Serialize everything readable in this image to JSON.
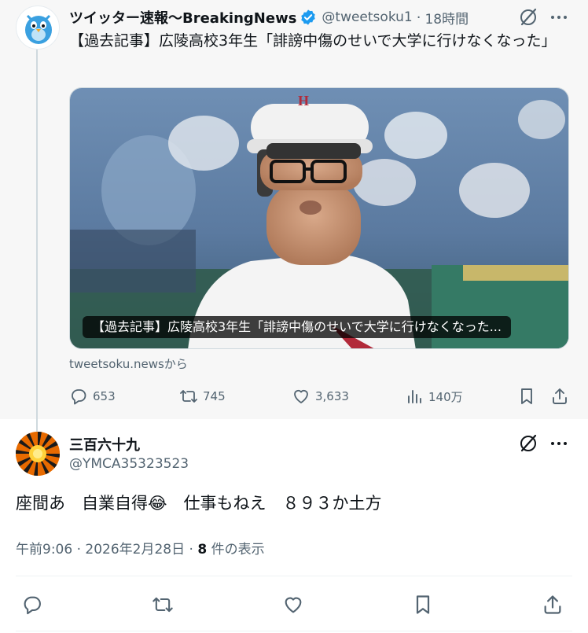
{
  "parent_tweet": {
    "display_name": "ツイッター速報〜BreakingNews",
    "handle": "@tweetsoku1",
    "separator": "·",
    "time": "18時間",
    "text": "【過去記事】広陵高校3年生「誹謗中傷のせいで大学に行けなくなった」",
    "card": {
      "caption": "【過去記事】広陵高校3年生「誹謗中傷のせいで大学に行けなくなった...",
      "source": "tweetsoku.newsから"
    },
    "metrics": {
      "replies": "653",
      "retweets": "745",
      "likes": "3,633",
      "views": "140万"
    },
    "icons": [
      "grok-icon",
      "more-icon",
      "verified-badge-icon",
      "reply-icon",
      "retweet-icon",
      "like-icon",
      "views-icon",
      "bookmark-icon",
      "share-icon"
    ]
  },
  "reply_tweet": {
    "display_name": "三百六十九",
    "handle": "@YMCA35323523",
    "text": "座間あ　自業自得😂　仕事もねえ　８９３か土方",
    "meta": {
      "time": "午前9:06",
      "sep1": "·",
      "date": "2026年2月28日",
      "sep2": "·",
      "view_count": "8",
      "view_label": "件の表示"
    }
  },
  "colors": {
    "text_primary": "#0f1419",
    "text_secondary": "#536471",
    "verified": "#1d9bf0",
    "parent_bg": "#f7f7f7",
    "border": "#cfd9de"
  }
}
